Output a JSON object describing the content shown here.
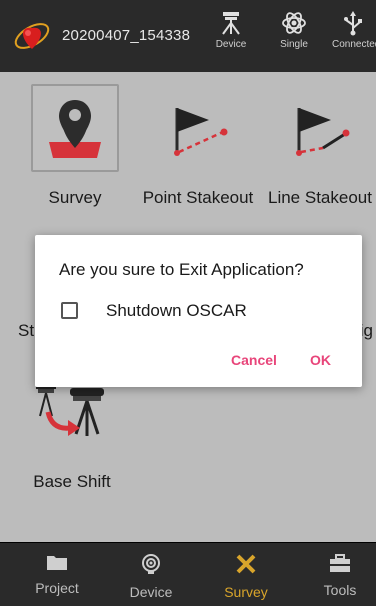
{
  "topbar": {
    "project_name": "20200407_154338",
    "items": [
      {
        "label": "Device",
        "icon": "gnss-receiver-icon"
      },
      {
        "label": "Single",
        "icon": "satellite-icon"
      },
      {
        "label": "Connected",
        "icon": "usb-icon"
      }
    ]
  },
  "main": {
    "tiles": [
      {
        "label": "Survey",
        "icon": "map-pin-icon",
        "selected": true
      },
      {
        "label": "Point Stakeout",
        "icon": "point-stakeout-icon"
      },
      {
        "label": "Line Stakeout",
        "icon": "line-stakeout-icon"
      },
      {
        "label": "Base Shift",
        "icon": "base-shift-icon"
      }
    ],
    "partial_left": "St",
    "partial_right": "fig"
  },
  "dialog": {
    "title": "Are you sure to Exit Application?",
    "checkbox_label": "Shutdown OSCAR",
    "checked": false,
    "cancel_label": "Cancel",
    "ok_label": "OK"
  },
  "bottomnav": {
    "items": [
      {
        "label": "Project",
        "icon": "folder-icon"
      },
      {
        "label": "Device",
        "icon": "device-icon"
      },
      {
        "label": "Survey",
        "icon": "survey-tools-icon",
        "active": true
      },
      {
        "label": "Tools",
        "icon": "toolbox-icon"
      }
    ]
  },
  "colors": {
    "accent": "#e8457a",
    "active_tab": "#d9a52b",
    "bar_bg": "#2a2a2a",
    "main_bg": "#bcbcbc"
  }
}
